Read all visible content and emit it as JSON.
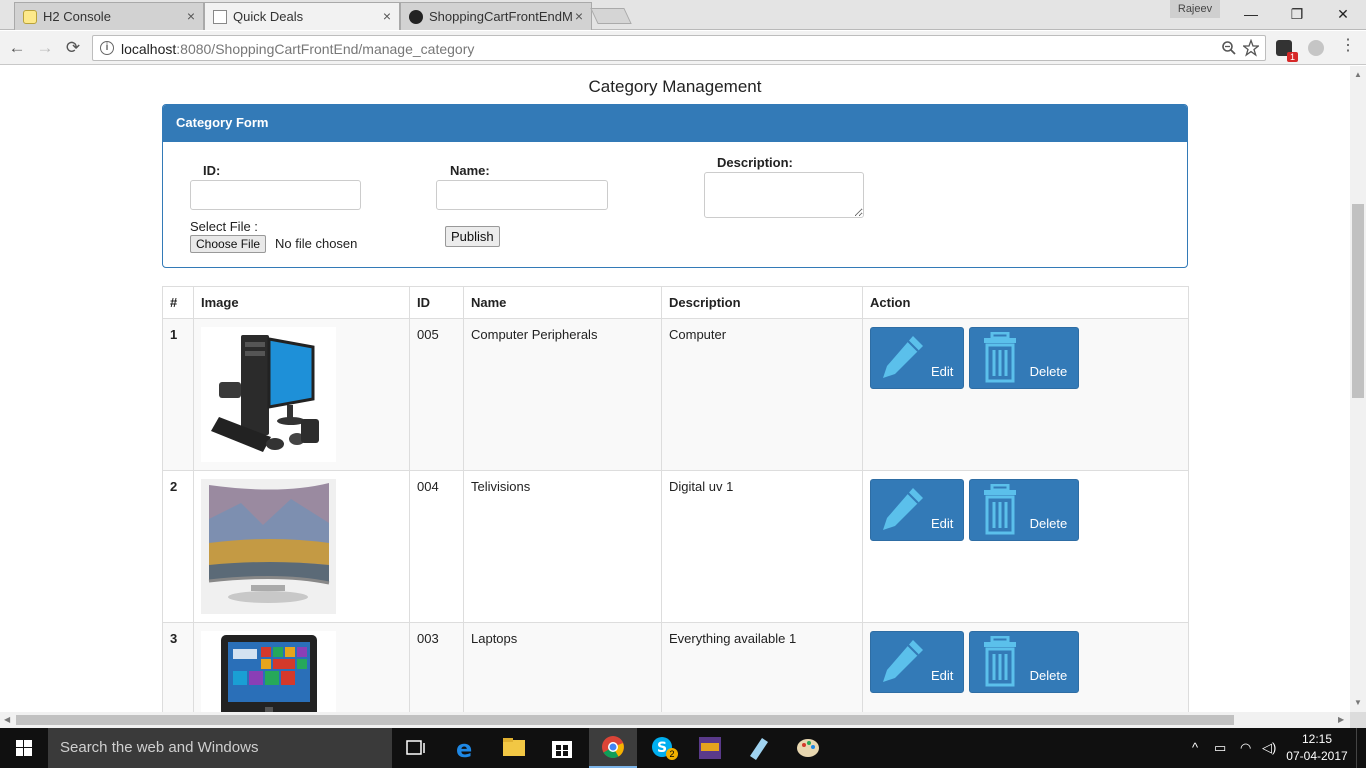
{
  "browser": {
    "tabs": [
      {
        "label": "H2 Console",
        "close": "×"
      },
      {
        "label": "Quick Deals",
        "close": "×"
      },
      {
        "label": "ShoppingCartFrontEndM",
        "close": "×"
      }
    ],
    "profile_name": "Rajeev",
    "window_controls": {
      "minimize": "—",
      "restore": "❐",
      "close": "✕"
    },
    "nav": {
      "back": "←",
      "forward": "→",
      "reload": "⟳"
    },
    "url_host": "localhost",
    "url_rest": ":8080/ShoppingCartFrontEnd/manage_category",
    "extension_badge": "1"
  },
  "page": {
    "title": "Category Management",
    "form": {
      "heading": "Category Form",
      "id_label": "ID:",
      "id_value": "",
      "name_label": "Name:",
      "name_value": "",
      "description_label": "Description:",
      "description_value": "",
      "file_label": "Select File :",
      "file_button": "Choose File",
      "file_status": "No file chosen",
      "publish_button": "Publish"
    },
    "table": {
      "headers": [
        "#",
        "Image",
        "ID",
        "Name",
        "Description",
        "Action"
      ],
      "rows": [
        {
          "num": "1",
          "image": "computer-peripherals-image",
          "id": "005",
          "name": "Computer Peripherals",
          "description": "Computer",
          "edit": "Edit",
          "delete": "Delete"
        },
        {
          "num": "2",
          "image": "television-image",
          "id": "004",
          "name": "Telivisions",
          "description": "Digital uv 1",
          "edit": "Edit",
          "delete": "Delete"
        },
        {
          "num": "3",
          "image": "laptop-image",
          "id": "003",
          "name": "Laptops",
          "description": "Everything available 1",
          "edit": "Edit",
          "delete": "Delete"
        }
      ]
    }
  },
  "taskbar": {
    "search_placeholder": "Search the web and Windows",
    "time": "12:15",
    "date": "07-04-2017",
    "skype_badge": "2"
  },
  "colors": {
    "primary": "#337ab7",
    "icon_light": "#5bc0eb"
  }
}
